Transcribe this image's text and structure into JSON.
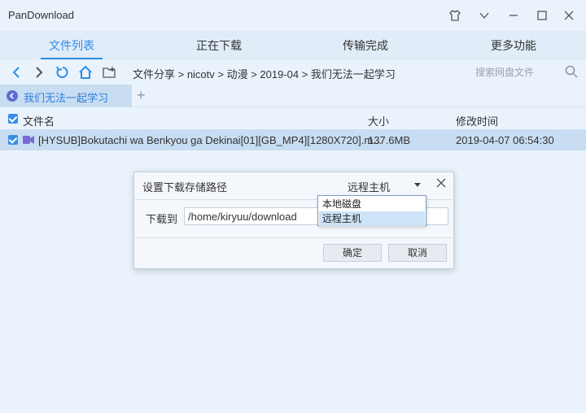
{
  "window": {
    "title": "PanDownload"
  },
  "tabs": [
    {
      "label": "文件列表",
      "active": true
    },
    {
      "label": "正在下载",
      "active": false
    },
    {
      "label": "传输完成",
      "active": false
    },
    {
      "label": "更多功能",
      "active": false
    }
  ],
  "toolbar": {
    "breadcrumb": "文件分享 > nicotv > 动漫 > 2019-04 > 我们无法一起学习",
    "search_placeholder": "搜索网盘文件",
    "icons": [
      "back-icon",
      "forward-icon",
      "refresh-icon",
      "home-icon",
      "new-folder-icon",
      "search-icon"
    ]
  },
  "share_tab": {
    "label": "我们无法一起学习",
    "add_label": "+"
  },
  "file_table": {
    "columns": [
      "文件名",
      "大小",
      "修改时间"
    ],
    "rows": [
      {
        "name": "[HYSUB]Bokutachi wa Benkyou ga Dekinai[01][GB_MP4][1280X720].m...",
        "size": "137.6MB",
        "modified": "2019-04-07 06:54:30",
        "checked": true
      }
    ]
  },
  "dialog": {
    "title": "设置下载存储路径",
    "host_selected": "远程主机",
    "label": "下载到",
    "path": "/home/kiryuu/download",
    "confirm_label": "确定",
    "cancel_label": "取消",
    "dropdown_options": [
      "本地磁盘",
      "远程主机"
    ],
    "dropdown_highlighted": "远程主机"
  },
  "colors": {
    "accent": "#2d8ce8",
    "background": "#eaf3fc",
    "selection": "#c9ddf2"
  }
}
